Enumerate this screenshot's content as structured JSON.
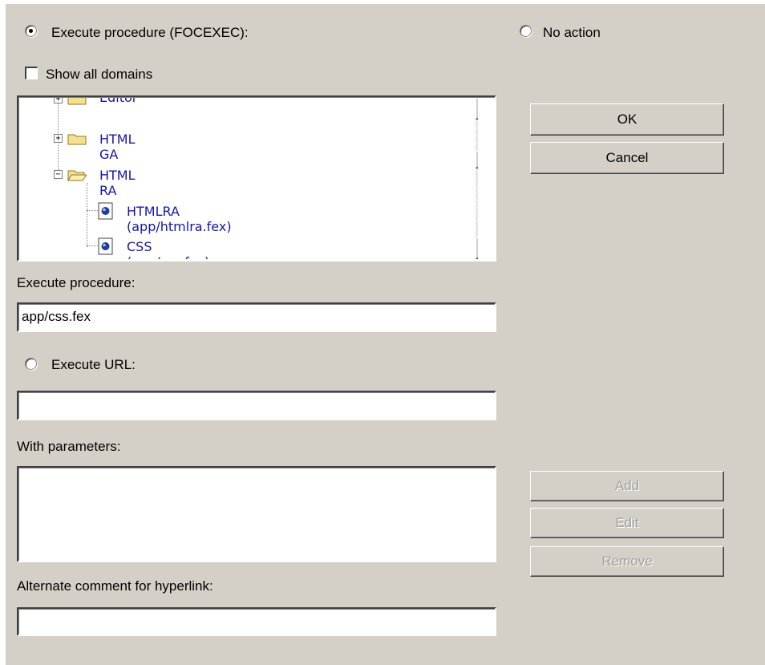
{
  "options": {
    "execute_procedure_focexec": "Execute procedure (FOCEXEC):",
    "no_action": "No action",
    "show_all_domains": "Show all domains",
    "execute_url": "Execute URL:"
  },
  "tree": {
    "items": [
      {
        "label": "Editor",
        "type": "folder",
        "expanded": false
      },
      {
        "label": "HTML GA",
        "type": "folder",
        "expanded": false
      },
      {
        "label": "HTML RA",
        "type": "folder",
        "expanded": true
      },
      {
        "label": "HTMLRA (app/htmlra.fex)",
        "type": "procedure"
      },
      {
        "label": "CSS (app/css.fex)",
        "type": "procedure"
      }
    ]
  },
  "fields": {
    "execute_procedure_label": "Execute procedure:",
    "execute_procedure_value": "app/css.fex",
    "execute_url_value": "",
    "with_parameters_label": "With parameters:",
    "alternate_comment_label": "Alternate comment for hyperlink:",
    "alternate_comment_value": ""
  },
  "buttons": {
    "ok": "OK",
    "cancel": "Cancel",
    "add": "Add",
    "edit": "Edit",
    "remove": "Remove"
  },
  "icons": [
    "folder-icon",
    "open-folder-icon",
    "procedure-icon",
    "expand-icon",
    "collapse-icon"
  ]
}
